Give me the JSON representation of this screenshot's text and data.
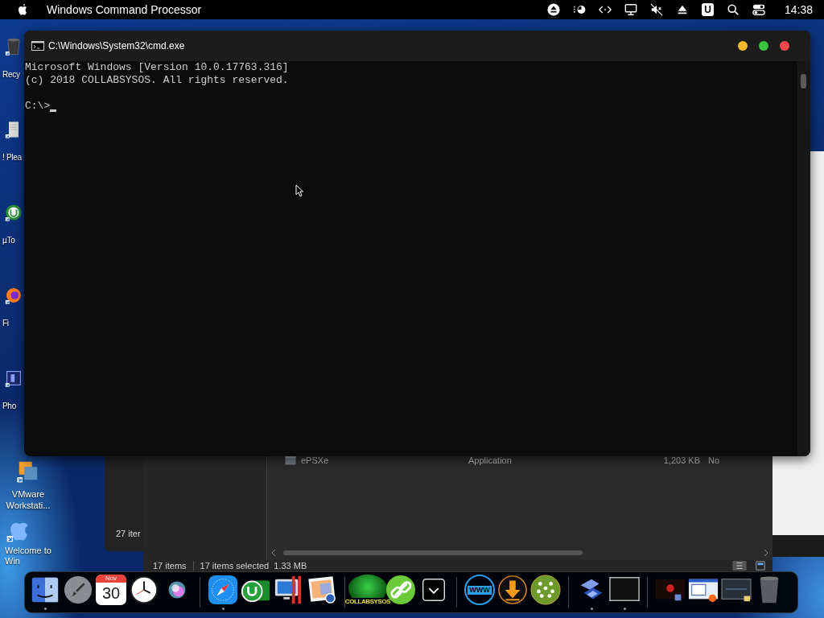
{
  "menu_bar": {
    "app_name": "Windows Command Processor",
    "badge": "U",
    "clock": "14:38"
  },
  "desktop_icons": [
    {
      "label": "Recy",
      "kind": "bin"
    },
    {
      "label": "! Plea",
      "kind": "doc"
    },
    {
      "label": "µTo",
      "kind": "utorrent"
    },
    {
      "label": "Fi",
      "kind": "firefox"
    },
    {
      "label": "Pho",
      "kind": "photo"
    },
    {
      "label": "VMware Workstati...",
      "kind": "vmware"
    },
    {
      "label": "Welcome to Win",
      "kind": "apple"
    }
  ],
  "explorer": {
    "back_status": "27 iter",
    "row": {
      "name": "ePSXe",
      "type": "Application",
      "size": "1,203 KB",
      "column_4": "No"
    },
    "status_items": "17 items",
    "status_selected": "17 items selected  1.33 MB"
  },
  "cmd_window": {
    "title": "C:\\Windows\\System32\\cmd.exe",
    "lines": [
      "Microsoft Windows [Version 10.0.17763.316]",
      "(c) 2018 COLLABSYSOS. All rights reserved."
    ],
    "prompt": "C:\\>"
  },
  "dock": [
    {
      "kind": "finder",
      "running": true
    },
    {
      "kind": "launchpad",
      "running": false
    },
    {
      "kind": "calendar",
      "month": "Nov",
      "day": "30",
      "running": false
    },
    {
      "kind": "clock",
      "running": false
    },
    {
      "kind": "siri",
      "running": false
    },
    {
      "kind": "separator"
    },
    {
      "kind": "safari",
      "running": true
    },
    {
      "kind": "utorrent",
      "running": false
    },
    {
      "kind": "parallels",
      "running": false
    },
    {
      "kind": "photos",
      "running": false
    },
    {
      "kind": "separator"
    },
    {
      "kind": "globe_green",
      "text": "COLLABSYSOS",
      "running": false
    },
    {
      "kind": "link",
      "running": false
    },
    {
      "kind": "chevron",
      "running": false
    },
    {
      "kind": "separator"
    },
    {
      "kind": "www",
      "text": "WWW",
      "running": false
    },
    {
      "kind": "download",
      "running": false
    },
    {
      "kind": "people",
      "running": false
    },
    {
      "kind": "separator"
    },
    {
      "kind": "ps2",
      "running": true
    },
    {
      "kind": "terminal",
      "running": true
    },
    {
      "kind": "separator"
    },
    {
      "kind": "thumb_red",
      "running": false
    },
    {
      "kind": "thumb_window",
      "running": false
    },
    {
      "kind": "thumb_dark",
      "running": false
    },
    {
      "kind": "trash",
      "running": false
    }
  ]
}
